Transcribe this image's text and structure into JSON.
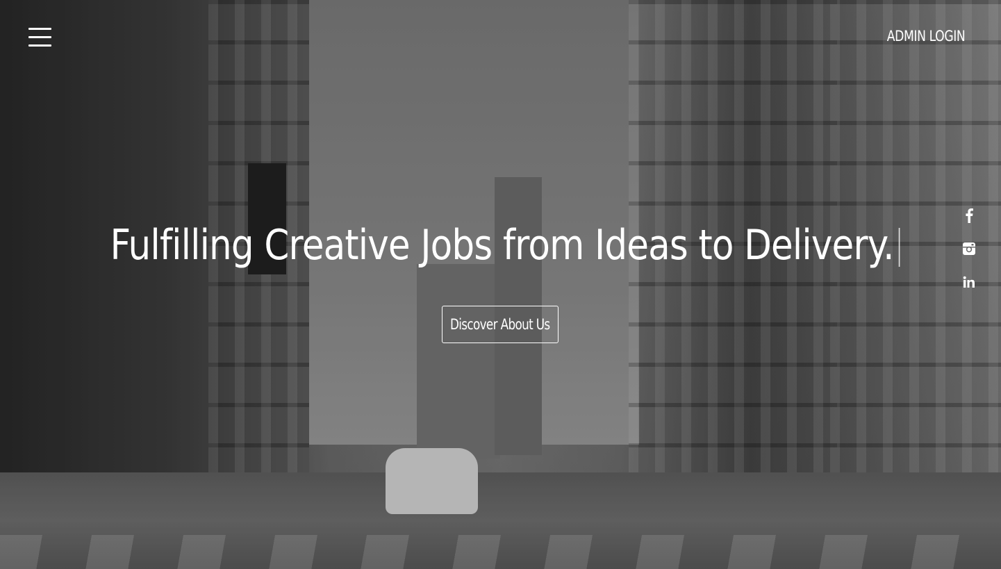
{
  "header": {
    "menu_icon": "hamburger-menu-icon",
    "admin_login_label": "ADMIN LOGIN"
  },
  "hero": {
    "headline": "Fulfilling Creative Jobs from Ideas to Delivery.",
    "cta_label": "Discover About Us",
    "background": "grayscale city street photograph"
  },
  "social": {
    "items": [
      {
        "icon": "facebook-icon"
      },
      {
        "icon": "instagram-icon"
      },
      {
        "icon": "linkedin-icon"
      }
    ]
  },
  "colors": {
    "text": "#ffffff",
    "border": "#ffffff"
  }
}
